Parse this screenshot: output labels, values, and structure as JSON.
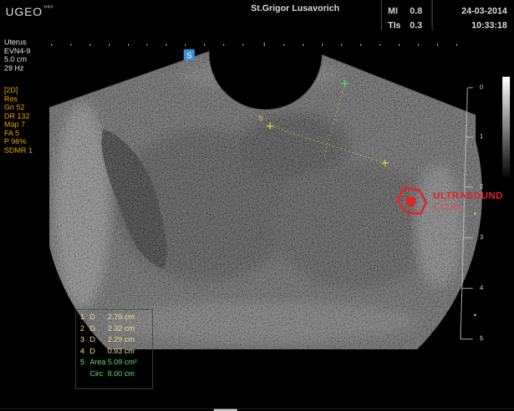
{
  "header": {
    "logo": "UGEO",
    "logo_sub": "H60",
    "patient": "St.Grigor Lusavorich",
    "mi_label": "MI",
    "mi_value": "0.8",
    "tis_label": "TIs",
    "tis_value": "0.3",
    "date": "24-03-2014",
    "time": "10:33:18"
  },
  "probe": [
    "Uterus",
    "EVN4-9",
    "5.0 cm",
    "29 Hz"
  ],
  "params": [
    "[2D]",
    "Res",
    "Gn  52",
    "DR  132",
    "Map 7",
    "FA  5",
    "P    96%",
    "SDMR 1"
  ],
  "measurements": [
    {
      "n": "1",
      "key": "D",
      "value": "2.79 cm"
    },
    {
      "n": "2",
      "key": "D",
      "value": "2.32 cm"
    },
    {
      "n": "3",
      "key": "D",
      "value": "2.29 cm"
    },
    {
      "n": "4",
      "key": "D",
      "value": "0.93 cm"
    },
    {
      "n": "5",
      "key": "Area",
      "value": "5.09 cm²"
    },
    {
      "n": "",
      "key": "Circ",
      "value": "8.00 cm"
    }
  ],
  "depth_scale": [
    "0",
    "1",
    "2",
    "3",
    "4",
    "5"
  ],
  "caliper_label": "5",
  "watermark": {
    "line1": "ULTRASOUND",
    "line2": "CLUB"
  },
  "colors": {
    "params": "#f0a000",
    "caliper_yellow": "#e8d040",
    "caliper_green": "#4fe060",
    "watermark": "#e02525"
  }
}
